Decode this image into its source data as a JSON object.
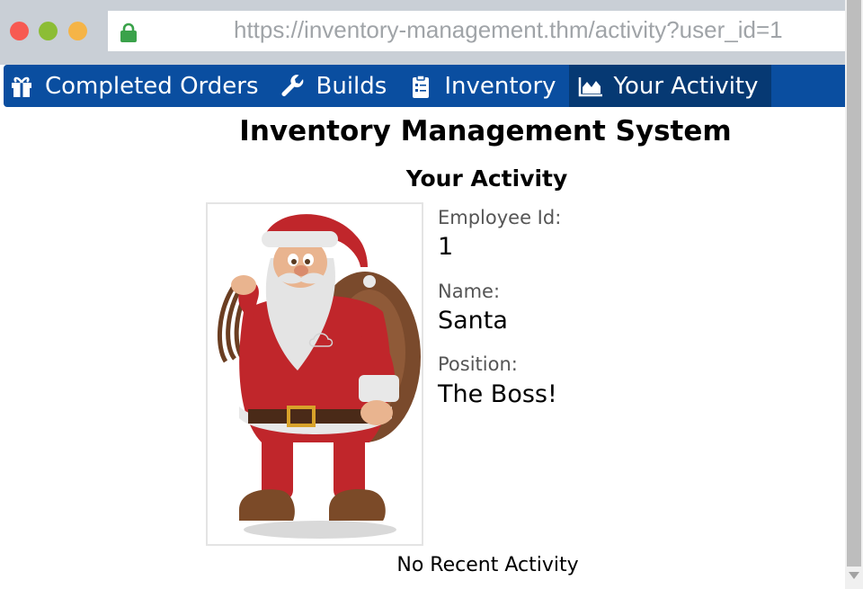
{
  "browser": {
    "url": "https://inventory-management.thm/activity?user_id=1"
  },
  "nav": {
    "items": [
      {
        "label": "Completed Orders",
        "icon": "gift-icon"
      },
      {
        "label": "Builds",
        "icon": "wrench-icon"
      },
      {
        "label": "Inventory",
        "icon": "clipboard-icon"
      },
      {
        "label": "Your Activity",
        "icon": "area-chart-icon",
        "active": true
      }
    ]
  },
  "page": {
    "title": "Inventory Management System",
    "subtitle": "Your Activity"
  },
  "profile": {
    "employee_id_label": "Employee Id:",
    "employee_id": "1",
    "name_label": "Name:",
    "name": "Santa",
    "position_label": "Position:",
    "position": "The Boss!"
  },
  "activity": {
    "empty_text": "No Recent Activity"
  },
  "colors": {
    "nav_bg": "#0a4ea0",
    "nav_active_bg": "#063973",
    "chrome_bg": "#c9cfd6"
  }
}
